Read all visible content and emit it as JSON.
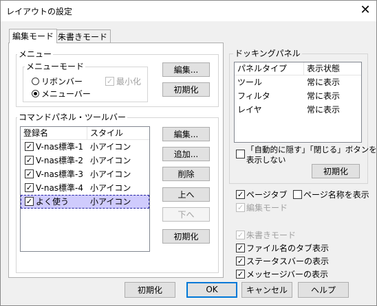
{
  "window": {
    "title": "レイアウトの設定",
    "close_glyph": "✕"
  },
  "tabs": [
    {
      "label": "編集モード",
      "active": true
    },
    {
      "label": "朱書きモード",
      "active": false
    }
  ],
  "menu_group": {
    "label": "メニュー",
    "mode_label": "メニューモード",
    "ribbon_label": "リボンバー",
    "menubar_label": "メニューバー",
    "minimize_label": "最小化",
    "edit_button": "編集...",
    "reset_button": "初期化"
  },
  "command_group": {
    "label": "コマンドパネル・ツールバー",
    "headers": [
      "登録名",
      "スタイル"
    ],
    "rows": [
      {
        "name": "V-nas標準-1",
        "style": "小アイコン",
        "checked": true
      },
      {
        "name": "V-nas標準-2",
        "style": "小アイコン",
        "checked": true
      },
      {
        "name": "V-nas標準-3",
        "style": "小アイコン",
        "checked": true
      },
      {
        "name": "V-nas標準-4",
        "style": "小アイコン",
        "checked": true
      },
      {
        "name": "よく使う",
        "style": "小アイコン",
        "checked": true,
        "selected": true
      }
    ],
    "buttons": {
      "edit": "編集...",
      "add": "追加...",
      "delete": "削除",
      "up": "上へ",
      "down": "下へ",
      "reset": "初期化"
    }
  },
  "docking": {
    "label": "ドッキングパネル",
    "headers": [
      "パネルタイプ",
      "表示状態"
    ],
    "rows": [
      {
        "type": "ツール",
        "state": "常に表示"
      },
      {
        "type": "フィルタ",
        "state": "常に表示"
      },
      {
        "type": "レイヤ",
        "state": "常に表示"
      }
    ],
    "autohide_line1": "「自動的に隠す」「閉じる」ボタンを",
    "autohide_line2": "表示しない",
    "reset_button": "初期化"
  },
  "options": {
    "page_tab": "ページタブ",
    "page_name": "ページ名称を表示",
    "edit_mode": "編集モード",
    "red_mode": "朱書きモード",
    "file_tab": "ファイル名のタブ表示",
    "status_bar": "ステータスバーの表示",
    "message_bar": "メッセージバーの表示"
  },
  "footer": {
    "reset": "初期化",
    "ok": "OK",
    "cancel": "キャンセル",
    "help": "ヘルプ"
  },
  "check_glyph": "✓"
}
